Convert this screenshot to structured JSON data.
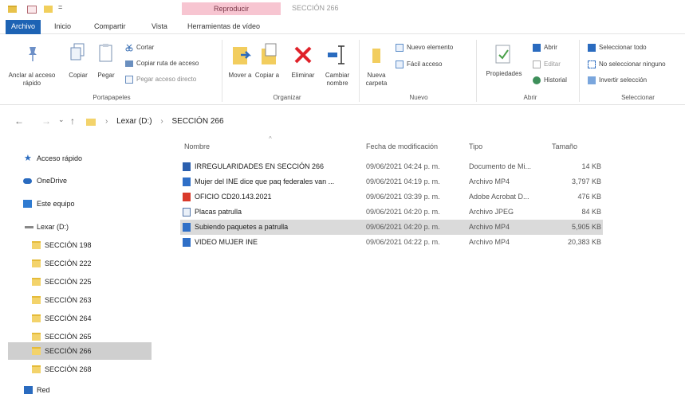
{
  "titlebar": {
    "quick_access_dropdown": "=",
    "context_tab": "Reproducir",
    "title": "SECCIÓN 266"
  },
  "ribbon_tabs": [
    "Archivo",
    "Inicio",
    "Compartir",
    "Vista",
    "Herramientas de vídeo"
  ],
  "ribbon": {
    "portapapeles": {
      "pin": "Anclar al acceso rápido",
      "copy": "Copiar",
      "paste": "Pegar",
      "cut": "Cortar",
      "copy_path": "Copiar ruta de acceso",
      "paste_shortcut": "Pegar acceso directo",
      "group": "Portapapeles"
    },
    "organizar": {
      "move_to": "Mover a",
      "copy_to": "Copiar a",
      "delete": "Eliminar",
      "rename": "Cambiar nombre",
      "group": "Organizar"
    },
    "nuevo": {
      "new_folder": "Nueva carpeta",
      "new_item": "Nuevo elemento",
      "easy_access": "Fácil acceso",
      "group": "Nuevo"
    },
    "abrir": {
      "properties": "Propiedades",
      "open": "Abrir",
      "edit": "Editar",
      "history": "Historial",
      "group": "Abrir"
    },
    "seleccionar": {
      "select_all": "Seleccionar todo",
      "select_none": "No seleccionar ninguno",
      "invert": "Invertir selección",
      "group": "Seleccionar"
    }
  },
  "addressbar": {
    "back": "←",
    "forward": "→",
    "recent": "⌄",
    "up": "↑",
    "breadcrumb": [
      "Lexar (D:)",
      "SECCIÓN 266"
    ]
  },
  "navpane": {
    "quick_access": "Acceso rápido",
    "onedrive": "OneDrive",
    "this_pc": "Este equipo",
    "drive": "Lexar (D:)",
    "folders": [
      "SECCIÓN 198",
      "SECCIÓN 222",
      "SECCIÓN 225",
      "SECCIÓN 263",
      "SECCIÓN 264",
      "SECCIÓN 265",
      "SECCIÓN 266",
      "SECCIÓN 268"
    ],
    "network": "Red"
  },
  "filelist": {
    "columns": {
      "name": "Nombre",
      "date": "Fecha de modificación",
      "type": "Tipo",
      "size": "Tamaño"
    },
    "rows": [
      {
        "name": "IRREGULARIDADES EN SECCIÓN 266",
        "date": "09/06/2021 04:24 p. m.",
        "type": "Documento de Mi...",
        "size": "14 KB",
        "icon": "word-document-icon"
      },
      {
        "name": "Mujer del INE dice que paq federales van ...",
        "date": "09/06/2021 04:19 p. m.",
        "type": "Archivo MP4",
        "size": "3,797 KB",
        "icon": "video-file-icon"
      },
      {
        "name": "OFICIO CD20.143.2021",
        "date": "09/06/2021 03:39 p. m.",
        "type": "Adobe Acrobat D...",
        "size": "476 KB",
        "icon": "pdf-file-icon"
      },
      {
        "name": "Placas patrulla",
        "date": "09/06/2021 04:20 p. m.",
        "type": "Archivo JPEG",
        "size": "84 KB",
        "icon": "image-file-icon"
      },
      {
        "name": "Subiendo paquetes a patrulla",
        "date": "09/06/2021 04:20 p. m.",
        "type": "Archivo MP4",
        "size": "5,905 KB",
        "icon": "video-file-icon"
      },
      {
        "name": "VIDEO MUJER INE",
        "date": "09/06/2021 04:22 p. m.",
        "type": "Archivo MP4",
        "size": "20,383 KB",
        "icon": "video-file-icon"
      }
    ]
  },
  "colors": {
    "accent": "#1d63b4",
    "context_tab": "#f7c5d1",
    "selected_row": "#dadada",
    "folder": "#f3d36b"
  }
}
